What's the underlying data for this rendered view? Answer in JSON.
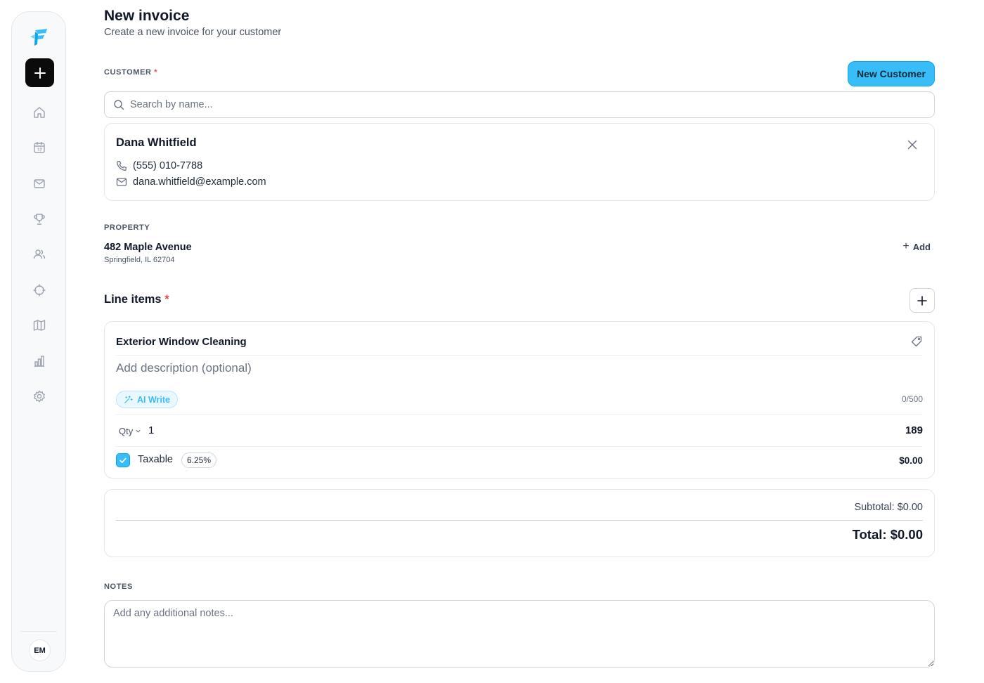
{
  "sidebar": {
    "logo": "brand-logo",
    "new_button_icon": "plus-icon",
    "nav": [
      "home-icon",
      "calendar-icon",
      "mail-icon",
      "trophy-icon",
      "users-icon",
      "crosshair-icon",
      "map-icon",
      "bar-chart-icon",
      "settings-icon"
    ],
    "avatar_initials": "EM"
  },
  "header": {
    "title": "New invoice",
    "subtitle": "Create a new invoice for your customer"
  },
  "customer": {
    "label": "CUSTOMER",
    "required_mark": "*",
    "new_button": "New Customer",
    "search_placeholder": "Search by name...",
    "name": "Dana Whitfield",
    "phone": "(555) 010-7788",
    "email": "dana.whitfield@example.com"
  },
  "property": {
    "label": "PROPERTY",
    "address": "482 Maple Avenue",
    "city": "Springfield, IL 62704",
    "add_label": "Add"
  },
  "line_items": {
    "title": "Line items",
    "required_mark": "*",
    "items": [
      {
        "name": "Exterior Window Cleaning",
        "description_placeholder": "Add description (optional)",
        "ai_write_label": "AI Write",
        "char_count": "0/500",
        "qty_label": "Qty",
        "qty": "1",
        "price": "189",
        "taxable_label": "Taxable",
        "taxable_checked": true,
        "tax_rate": "6.25%",
        "tax_amount": "$0.00"
      }
    ]
  },
  "totals": {
    "subtotal": "Subtotal: $0.00",
    "total": "Total: $0.00"
  },
  "notes": {
    "label": "NOTES",
    "placeholder": "Add any additional notes..."
  },
  "colors": {
    "accent": "#38bdf8",
    "required": "#ef4444",
    "dark_button": "#0b0b0b"
  }
}
